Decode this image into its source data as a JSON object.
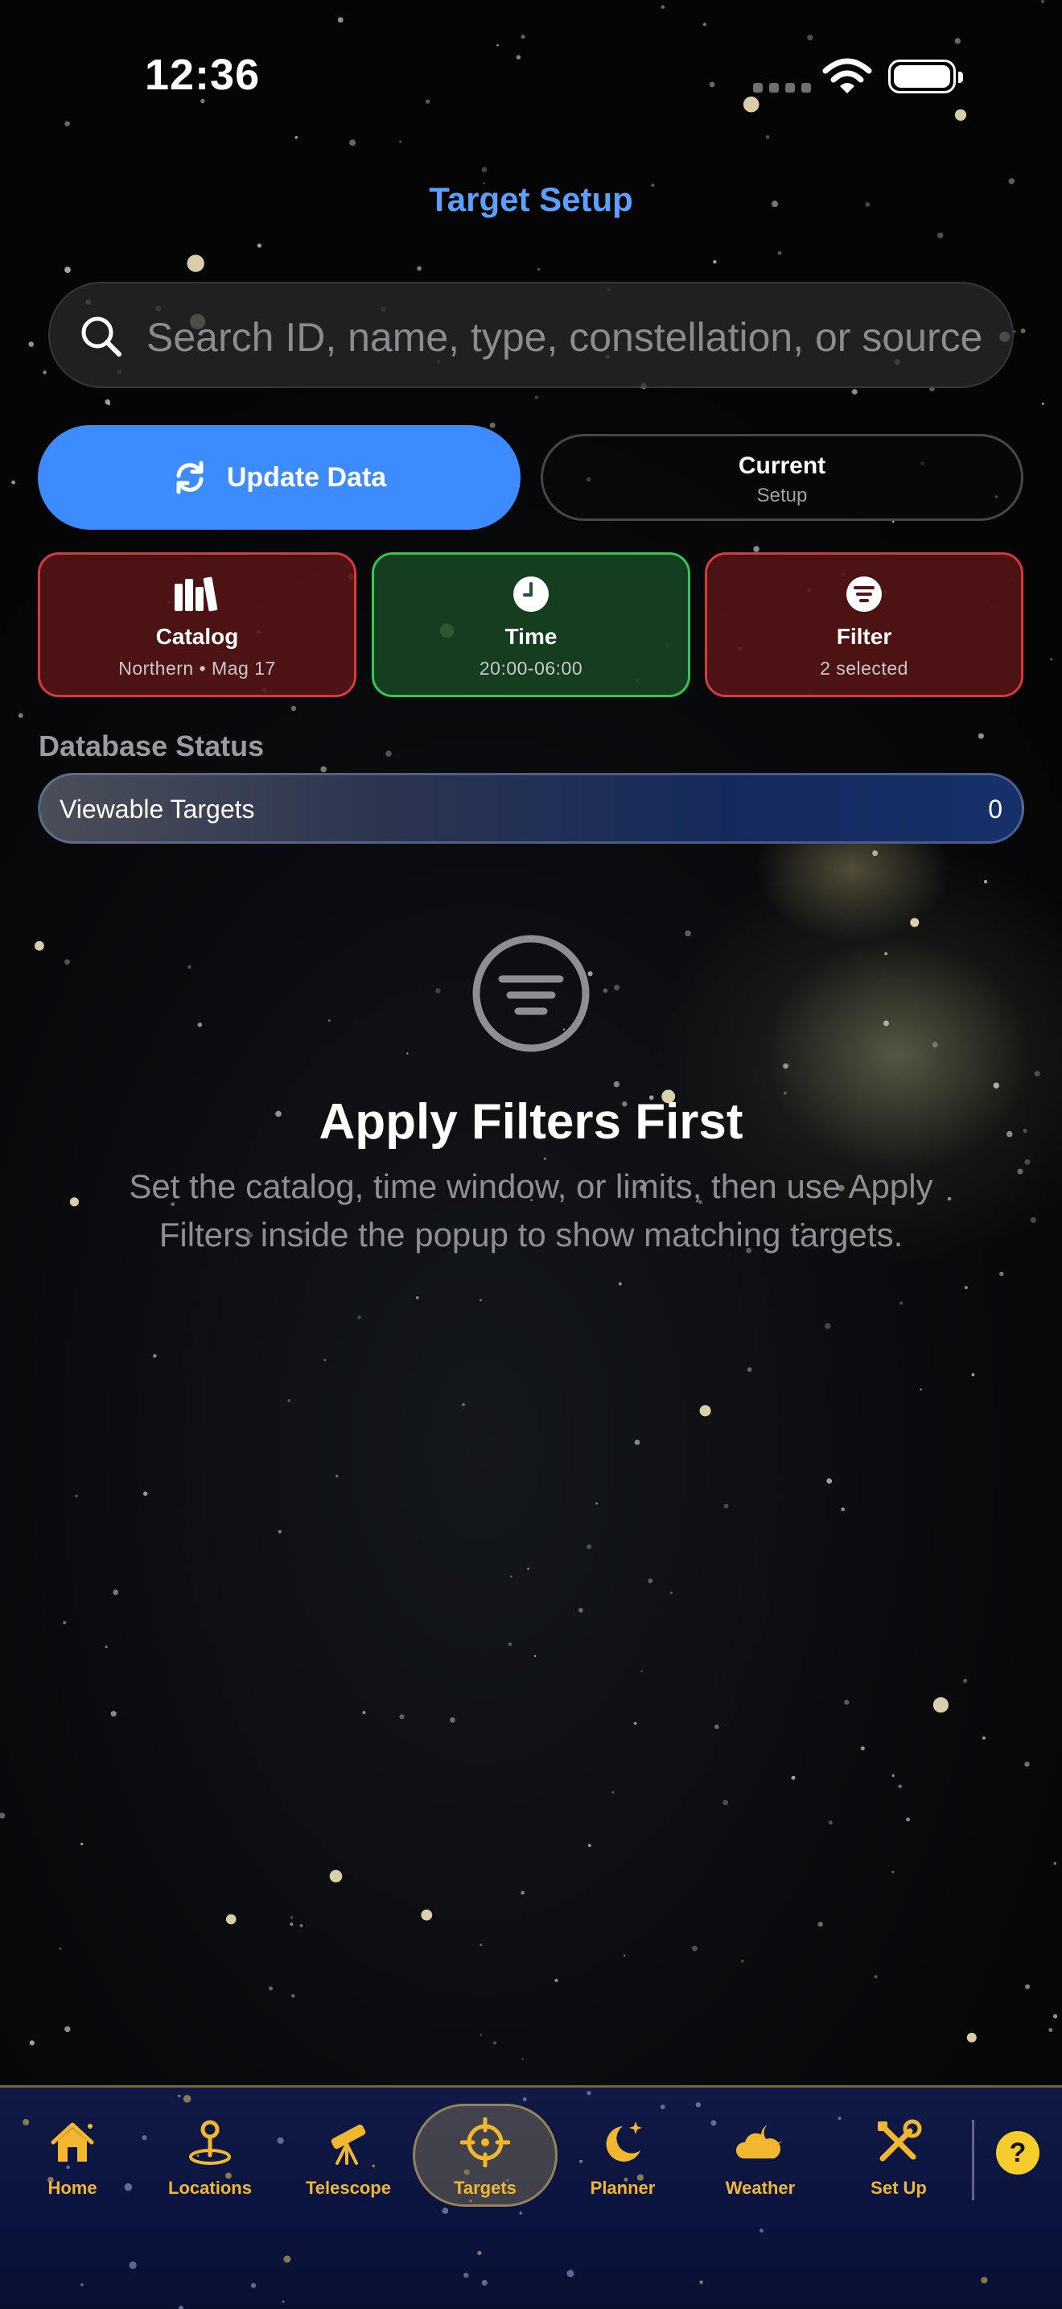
{
  "status_bar": {
    "time": "12:36"
  },
  "header": {
    "title": "Target Setup"
  },
  "search": {
    "placeholder": "Search ID, name, type, constellation, or source",
    "icon": "magnifier-icon"
  },
  "actions": {
    "update_label": "Update Data",
    "current_title": "Current",
    "current_subtitle": "Setup"
  },
  "cards": [
    {
      "title": "Catalog",
      "subtitle": "Northern • Mag 17",
      "status": "error",
      "icon": "books-icon"
    },
    {
      "title": "Time",
      "subtitle": "20:00-06:00",
      "status": "ok",
      "icon": "clock-icon"
    },
    {
      "title": "Filter",
      "subtitle": "2 selected",
      "status": "error",
      "icon": "filter-icon"
    }
  ],
  "database": {
    "section_label": "Database Status",
    "row_label": "Viewable Targets",
    "row_value": "0"
  },
  "empty_state": {
    "title": "Apply Filters First",
    "message": "Set the catalog, time window, or limits, then use Apply Filters inside the popup to show matching targets.",
    "icon": "filter-circle-icon"
  },
  "tabbar": {
    "items": [
      {
        "label": "Home",
        "icon": "house-icon"
      },
      {
        "label": "Locations",
        "icon": "map-pin-icon"
      },
      {
        "label": "Telescope",
        "icon": "telescope-icon"
      },
      {
        "label": "Targets",
        "icon": "crosshair-icon",
        "active": true
      },
      {
        "label": "Planner",
        "icon": "moon-stars-icon"
      },
      {
        "label": "Weather",
        "icon": "cloud-moon-icon"
      },
      {
        "label": "Set Up",
        "icon": "tools-icon"
      }
    ],
    "help_label": "?"
  },
  "colors": {
    "accent": "#3d8cff",
    "title_blue": "#5aa0ff",
    "tab_gold": "#f2b72f",
    "error_border": "#d53a3f",
    "ok_border": "#36c456"
  }
}
